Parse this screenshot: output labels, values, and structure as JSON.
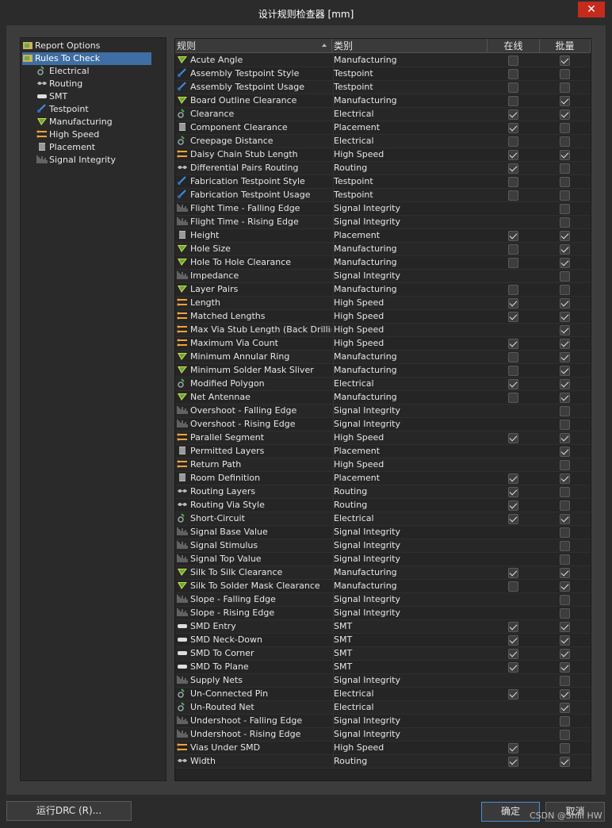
{
  "window": {
    "title": "设计规则检查器 [mm]",
    "close_glyph": "✕"
  },
  "tree": {
    "items": [
      {
        "label": "Report Options",
        "icon": "report-options-icon"
      },
      {
        "label": "Rules To Check",
        "icon": "rules-folder-icon",
        "selected": true
      },
      {
        "label": "Electrical",
        "icon": "electrical-icon"
      },
      {
        "label": "Routing",
        "icon": "routing-icon"
      },
      {
        "label": "SMT",
        "icon": "smt-icon"
      },
      {
        "label": "Testpoint",
        "icon": "testpoint-icon"
      },
      {
        "label": "Manufacturing",
        "icon": "manufacturing-icon"
      },
      {
        "label": "High Speed",
        "icon": "high-speed-icon"
      },
      {
        "label": "Placement",
        "icon": "placement-icon"
      },
      {
        "label": "Signal Integrity",
        "icon": "signal-integrity-icon"
      }
    ]
  },
  "table": {
    "headers": {
      "rule": "规则",
      "category": "类别",
      "online": "在线",
      "batch": "批量"
    },
    "rows": [
      {
        "rule": "Acute Angle",
        "category": "Manufacturing",
        "online": false,
        "batch": true
      },
      {
        "rule": "Assembly Testpoint Style",
        "category": "Testpoint",
        "online": false,
        "batch": false
      },
      {
        "rule": "Assembly Testpoint Usage",
        "category": "Testpoint",
        "online": false,
        "batch": false
      },
      {
        "rule": "Board Outline Clearance",
        "category": "Manufacturing",
        "online": false,
        "batch": true
      },
      {
        "rule": "Clearance",
        "category": "Electrical",
        "online": true,
        "batch": true
      },
      {
        "rule": "Component Clearance",
        "category": "Placement",
        "online": true,
        "batch": false
      },
      {
        "rule": "Creepage Distance",
        "category": "Electrical",
        "online": false,
        "batch": false
      },
      {
        "rule": "Daisy Chain Stub Length",
        "category": "High Speed",
        "online": true,
        "batch": true
      },
      {
        "rule": "Differential Pairs Routing",
        "category": "Routing",
        "online": true,
        "batch": false
      },
      {
        "rule": "Fabrication Testpoint Style",
        "category": "Testpoint",
        "online": false,
        "batch": false
      },
      {
        "rule": "Fabrication Testpoint Usage",
        "category": "Testpoint",
        "online": false,
        "batch": false
      },
      {
        "rule": "Flight Time - Falling Edge",
        "category": "Signal Integrity",
        "online": null,
        "batch": false
      },
      {
        "rule": "Flight Time - Rising Edge",
        "category": "Signal Integrity",
        "online": null,
        "batch": false
      },
      {
        "rule": "Height",
        "category": "Placement",
        "online": true,
        "batch": true
      },
      {
        "rule": "Hole Size",
        "category": "Manufacturing",
        "online": false,
        "batch": true
      },
      {
        "rule": "Hole To Hole Clearance",
        "category": "Manufacturing",
        "online": false,
        "batch": true
      },
      {
        "rule": "Impedance",
        "category": "Signal Integrity",
        "online": null,
        "batch": false
      },
      {
        "rule": "Layer Pairs",
        "category": "Manufacturing",
        "online": false,
        "batch": false
      },
      {
        "rule": "Length",
        "category": "High Speed",
        "online": true,
        "batch": true
      },
      {
        "rule": "Matched Lengths",
        "category": "High Speed",
        "online": true,
        "batch": true
      },
      {
        "rule": "Max Via Stub Length (Back Drilling)",
        "category": "High Speed",
        "online": null,
        "batch": true
      },
      {
        "rule": "Maximum Via Count",
        "category": "High Speed",
        "online": true,
        "batch": true
      },
      {
        "rule": "Minimum Annular Ring",
        "category": "Manufacturing",
        "online": false,
        "batch": true
      },
      {
        "rule": "Minimum Solder Mask Sliver",
        "category": "Manufacturing",
        "online": false,
        "batch": true
      },
      {
        "rule": "Modified Polygon",
        "category": "Electrical",
        "online": true,
        "batch": true
      },
      {
        "rule": "Net Antennae",
        "category": "Manufacturing",
        "online": false,
        "batch": true
      },
      {
        "rule": "Overshoot - Falling Edge",
        "category": "Signal Integrity",
        "online": null,
        "batch": false
      },
      {
        "rule": "Overshoot - Rising Edge",
        "category": "Signal Integrity",
        "online": null,
        "batch": false
      },
      {
        "rule": "Parallel Segment",
        "category": "High Speed",
        "online": true,
        "batch": true
      },
      {
        "rule": "Permitted Layers",
        "category": "Placement",
        "online": null,
        "batch": true
      },
      {
        "rule": "Return Path",
        "category": "High Speed",
        "online": null,
        "batch": false
      },
      {
        "rule": "Room Definition",
        "category": "Placement",
        "online": true,
        "batch": true
      },
      {
        "rule": "Routing Layers",
        "category": "Routing",
        "online": true,
        "batch": false
      },
      {
        "rule": "Routing Via Style",
        "category": "Routing",
        "online": true,
        "batch": false
      },
      {
        "rule": "Short-Circuit",
        "category": "Electrical",
        "online": true,
        "batch": true
      },
      {
        "rule": "Signal Base Value",
        "category": "Signal Integrity",
        "online": null,
        "batch": false
      },
      {
        "rule": "Signal Stimulus",
        "category": "Signal Integrity",
        "online": null,
        "batch": false
      },
      {
        "rule": "Signal Top Value",
        "category": "Signal Integrity",
        "online": null,
        "batch": false
      },
      {
        "rule": "Silk To Silk Clearance",
        "category": "Manufacturing",
        "online": true,
        "batch": true
      },
      {
        "rule": "Silk To Solder Mask Clearance",
        "category": "Manufacturing",
        "online": false,
        "batch": true
      },
      {
        "rule": "Slope - Falling Edge",
        "category": "Signal Integrity",
        "online": null,
        "batch": false
      },
      {
        "rule": "Slope - Rising Edge",
        "category": "Signal Integrity",
        "online": null,
        "batch": false
      },
      {
        "rule": "SMD Entry",
        "category": "SMT",
        "online": true,
        "batch": true
      },
      {
        "rule": "SMD Neck-Down",
        "category": "SMT",
        "online": true,
        "batch": true
      },
      {
        "rule": "SMD To Corner",
        "category": "SMT",
        "online": true,
        "batch": true
      },
      {
        "rule": "SMD To Plane",
        "category": "SMT",
        "online": true,
        "batch": true
      },
      {
        "rule": "Supply Nets",
        "category": "Signal Integrity",
        "online": null,
        "batch": false
      },
      {
        "rule": "Un-Connected Pin",
        "category": "Electrical",
        "online": true,
        "batch": true
      },
      {
        "rule": "Un-Routed Net",
        "category": "Electrical",
        "online": null,
        "batch": true
      },
      {
        "rule": "Undershoot - Falling Edge",
        "category": "Signal Integrity",
        "online": null,
        "batch": false
      },
      {
        "rule": "Undershoot - Rising Edge",
        "category": "Signal Integrity",
        "online": null,
        "batch": false
      },
      {
        "rule": "Vias Under SMD",
        "category": "High Speed",
        "online": true,
        "batch": false
      },
      {
        "rule": "Width",
        "category": "Routing",
        "online": true,
        "batch": true
      }
    ]
  },
  "buttons": {
    "run_drc": "运行DRC (R)...",
    "ok": "确定",
    "cancel": "取消"
  },
  "watermark": "CSDN @Shill HW",
  "colors": {
    "selection": "#3e6ea3",
    "close": "#c42b1c",
    "primary_border": "#4a8fd4"
  }
}
